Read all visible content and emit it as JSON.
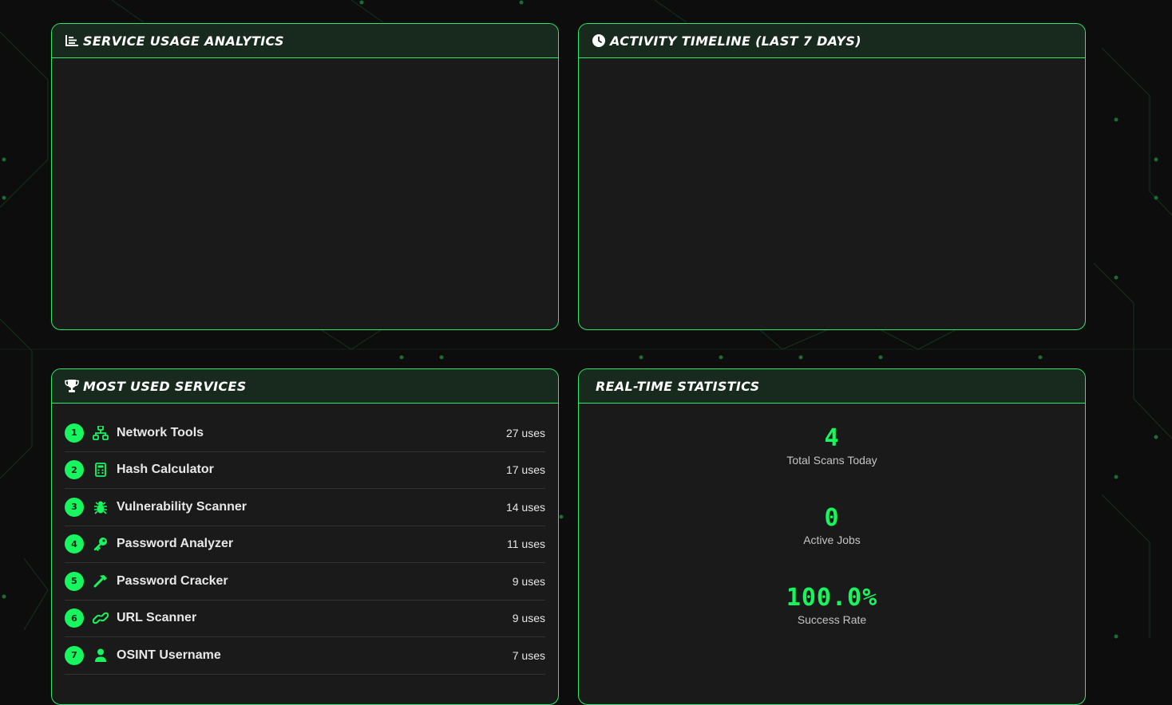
{
  "colors": {
    "accent": "#17f55f",
    "panel_bg": "#1a1a1a",
    "header_bg": "#18291d",
    "page_bg": "#0d0d0d"
  },
  "panels": {
    "usage": {
      "title": "Service Usage Analytics",
      "icon": "chart-bar-icon"
    },
    "timeline": {
      "title": "Activity Timeline (Last 7 Days)",
      "icon": "clock-icon"
    },
    "most_used": {
      "title": "Most Used Services",
      "icon": "trophy-icon"
    },
    "stats": {
      "title": "Real-Time Statistics"
    }
  },
  "services": [
    {
      "rank": "1",
      "icon": "network-icon",
      "name": "Network Tools",
      "uses": "27 uses"
    },
    {
      "rank": "2",
      "icon": "calculator-icon",
      "name": "Hash Calculator",
      "uses": "17 uses"
    },
    {
      "rank": "3",
      "icon": "bug-icon",
      "name": "Vulnerability Scanner",
      "uses": "14 uses"
    },
    {
      "rank": "4",
      "icon": "key-icon",
      "name": "Password Analyzer",
      "uses": "11 uses"
    },
    {
      "rank": "5",
      "icon": "hammer-icon",
      "name": "Password Cracker",
      "uses": "9 uses"
    },
    {
      "rank": "6",
      "icon": "link-icon",
      "name": "URL Scanner",
      "uses": "9 uses"
    },
    {
      "rank": "7",
      "icon": "user-icon",
      "name": "OSINT Username",
      "uses": "7 uses"
    }
  ],
  "stats": [
    {
      "value": "4",
      "label": "Total Scans Today"
    },
    {
      "value": "0",
      "label": "Active Jobs"
    },
    {
      "value": "100.0%",
      "label": "Success Rate"
    }
  ]
}
